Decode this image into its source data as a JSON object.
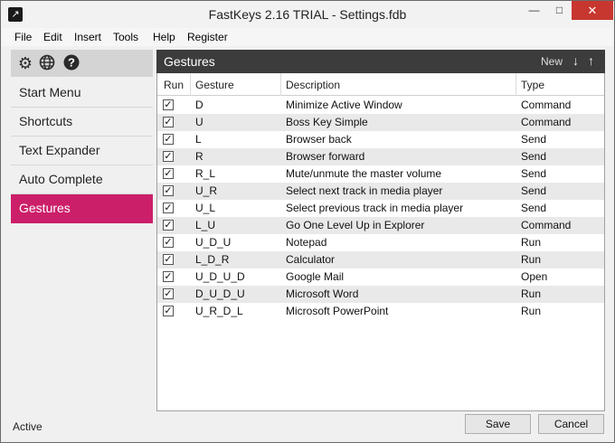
{
  "window": {
    "title": "FastKeys 2.16 TRIAL - Settings.fdb",
    "app_icon": "↗",
    "minimize_glyph": "—",
    "maximize_glyph": "□",
    "close_glyph": "✕",
    "close_color": "#c7372f"
  },
  "menu": [
    "File",
    "Edit",
    "Insert",
    "Tools",
    "Help",
    "Register"
  ],
  "toolbar": {
    "settings_icon": "⚙",
    "globe_icon": "🌐",
    "help_icon": "?"
  },
  "nav": {
    "items": [
      "Start Menu",
      "Shortcuts",
      "Text Expander",
      "Auto Complete",
      "Gestures"
    ],
    "active": "Gestures",
    "accent": "#cc1f6a"
  },
  "panel": {
    "title": "Gestures",
    "new_label": "New",
    "down_arrow": "↓",
    "up_arrow": "↑"
  },
  "table": {
    "columns": [
      "Run",
      "Gesture",
      "Description",
      "Type"
    ],
    "rows": [
      {
        "run": true,
        "gesture": "D",
        "description": "Minimize Active Window",
        "type": "Command"
      },
      {
        "run": true,
        "gesture": "U",
        "description": "Boss Key Simple",
        "type": "Command"
      },
      {
        "run": true,
        "gesture": "L",
        "description": "Browser back",
        "type": "Send"
      },
      {
        "run": true,
        "gesture": "R",
        "description": "Browser forward",
        "type": "Send"
      },
      {
        "run": true,
        "gesture": "R_L",
        "description": "Mute/unmute the master volume",
        "type": "Send"
      },
      {
        "run": true,
        "gesture": "U_R",
        "description": "Select next track in media player",
        "type": "Send"
      },
      {
        "run": true,
        "gesture": "U_L",
        "description": "Select previous track in media player",
        "type": "Send"
      },
      {
        "run": true,
        "gesture": "L_U",
        "description": "Go One Level Up in Explorer",
        "type": "Command"
      },
      {
        "run": true,
        "gesture": "U_D_U",
        "description": "Notepad",
        "type": "Run"
      },
      {
        "run": true,
        "gesture": "L_D_R",
        "description": "Calculator",
        "type": "Run"
      },
      {
        "run": true,
        "gesture": "U_D_U_D",
        "description": "Google Mail",
        "type": "Open"
      },
      {
        "run": true,
        "gesture": "D_U_D_U",
        "description": "Microsoft Word",
        "type": "Run"
      },
      {
        "run": true,
        "gesture": "U_R_D_L",
        "description": "Microsoft PowerPoint",
        "type": "Run"
      }
    ]
  },
  "status": "Active",
  "buttons": {
    "save": "Save",
    "cancel": "Cancel"
  }
}
